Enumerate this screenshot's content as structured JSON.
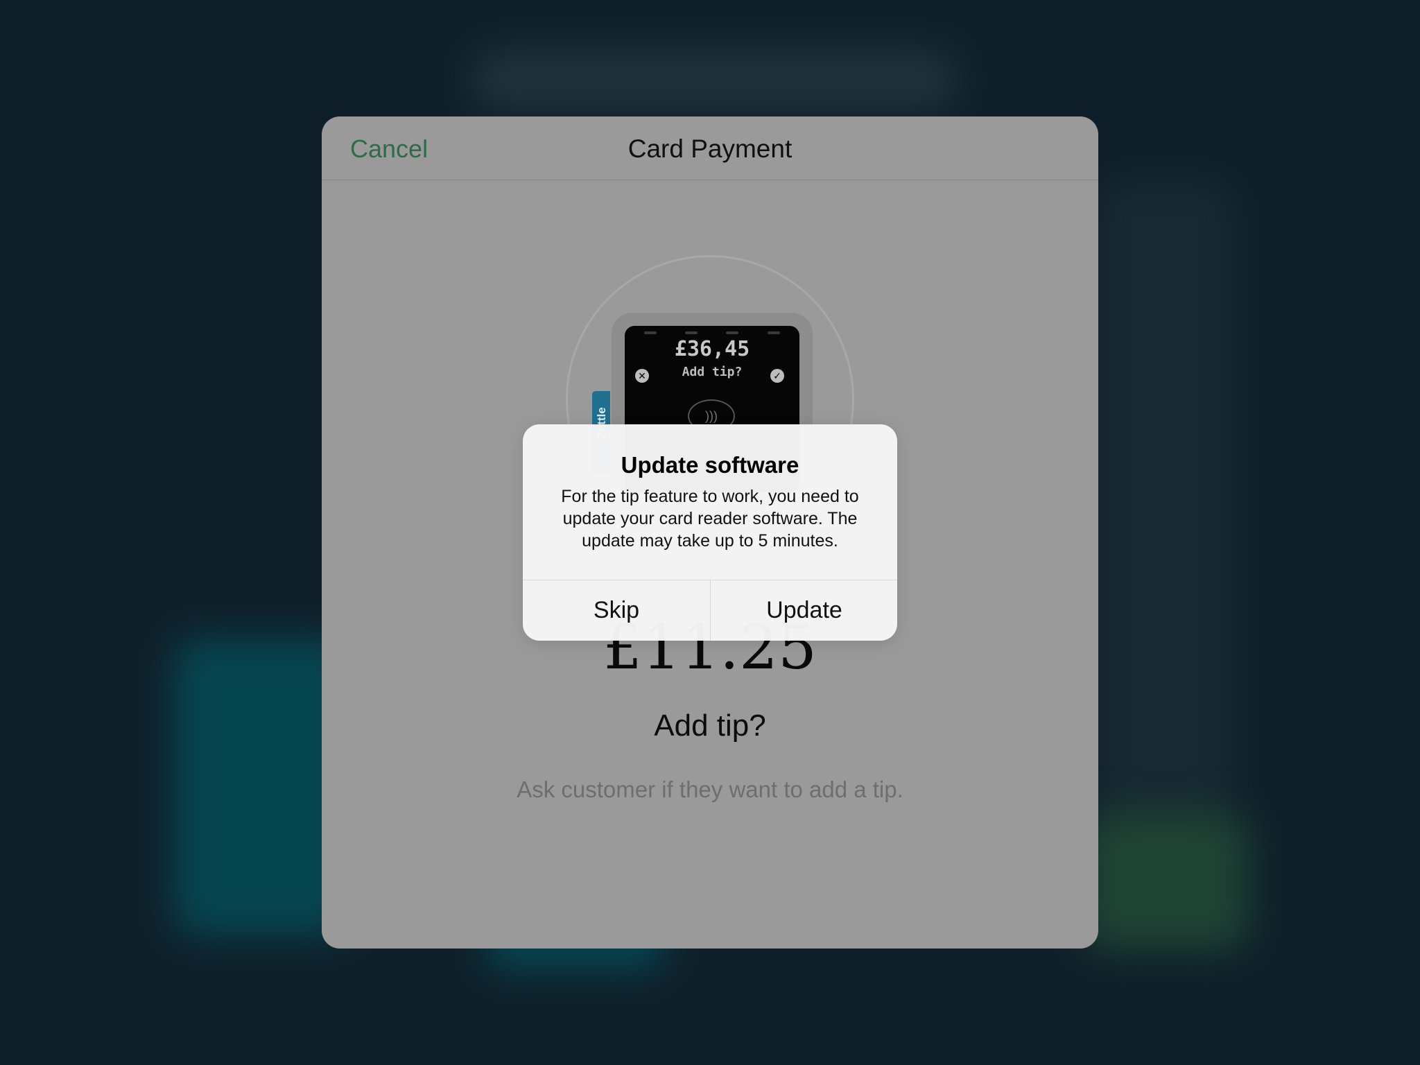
{
  "sheet": {
    "cancel_label": "Cancel",
    "title": "Card Payment"
  },
  "reader": {
    "amount": "£36,45",
    "prompt": "Add tip?",
    "brand": "Zettle"
  },
  "payment": {
    "amount": "£11.25",
    "heading": "Add tip?",
    "subtitle": "Ask customer if they want to add a tip."
  },
  "alert": {
    "title": "Update software",
    "message": "For the tip feature to work, you need to update your card reader software. The update may take up to 5 minutes.",
    "skip_label": "Skip",
    "update_label": "Update"
  },
  "colors": {
    "accent": "#2f6b48",
    "backdrop": "#0f1f29",
    "sheet_dimmed": "#9a9a9a"
  }
}
